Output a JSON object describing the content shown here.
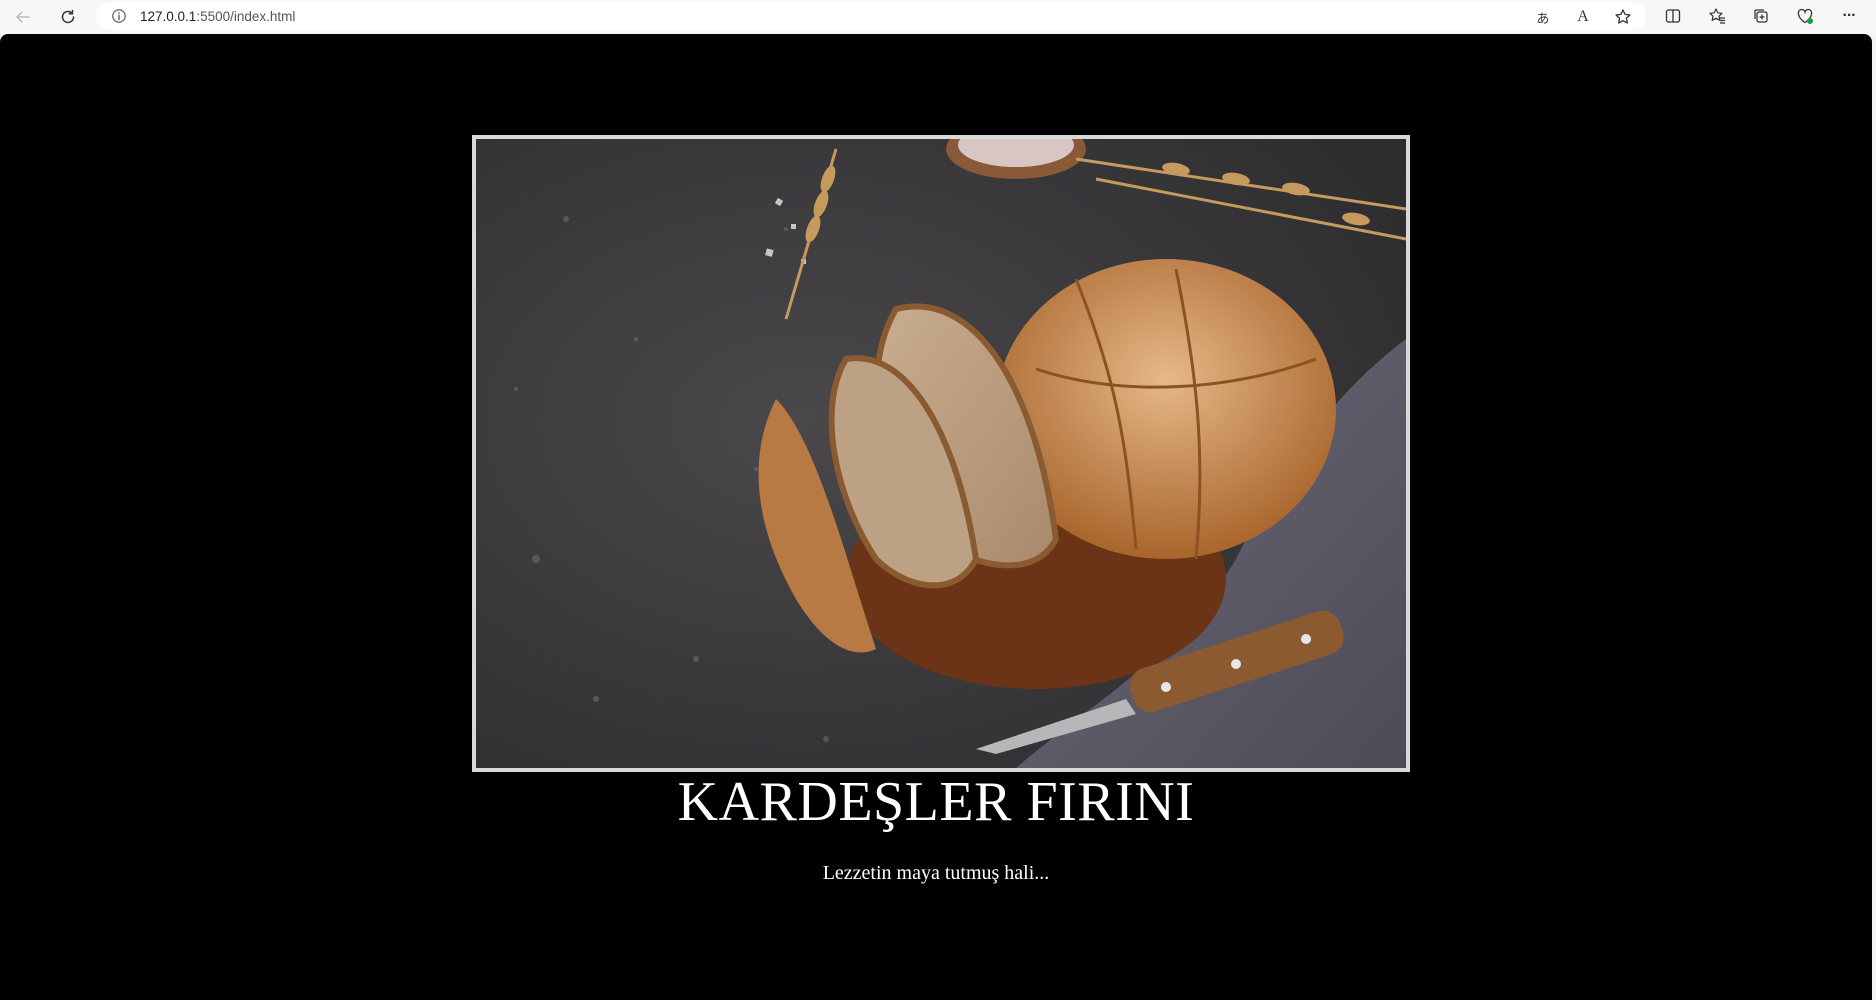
{
  "browser": {
    "url_host": "127.0.0.1",
    "url_rest": ":5500/index.html",
    "icons": {
      "back": "back-arrow-icon",
      "reload": "reload-icon",
      "info": "info-icon",
      "translate": "translate-icon",
      "read_aloud": "read-aloud-icon",
      "favorite": "star-icon",
      "split": "split-screen-icon",
      "favorites": "favorites-icon",
      "collections": "collections-icon",
      "health": "browser-essentials-icon",
      "menu": "more-menu-icon"
    },
    "translate_glyph": "あ",
    "read_aloud_glyph": "A",
    "menu_glyph": "···"
  },
  "page": {
    "background": "#000000",
    "hero_image": "bread-photo",
    "title": "KARDEŞLER FIRINI",
    "tagline": "Lezzetin maya tutmuş hali..."
  }
}
